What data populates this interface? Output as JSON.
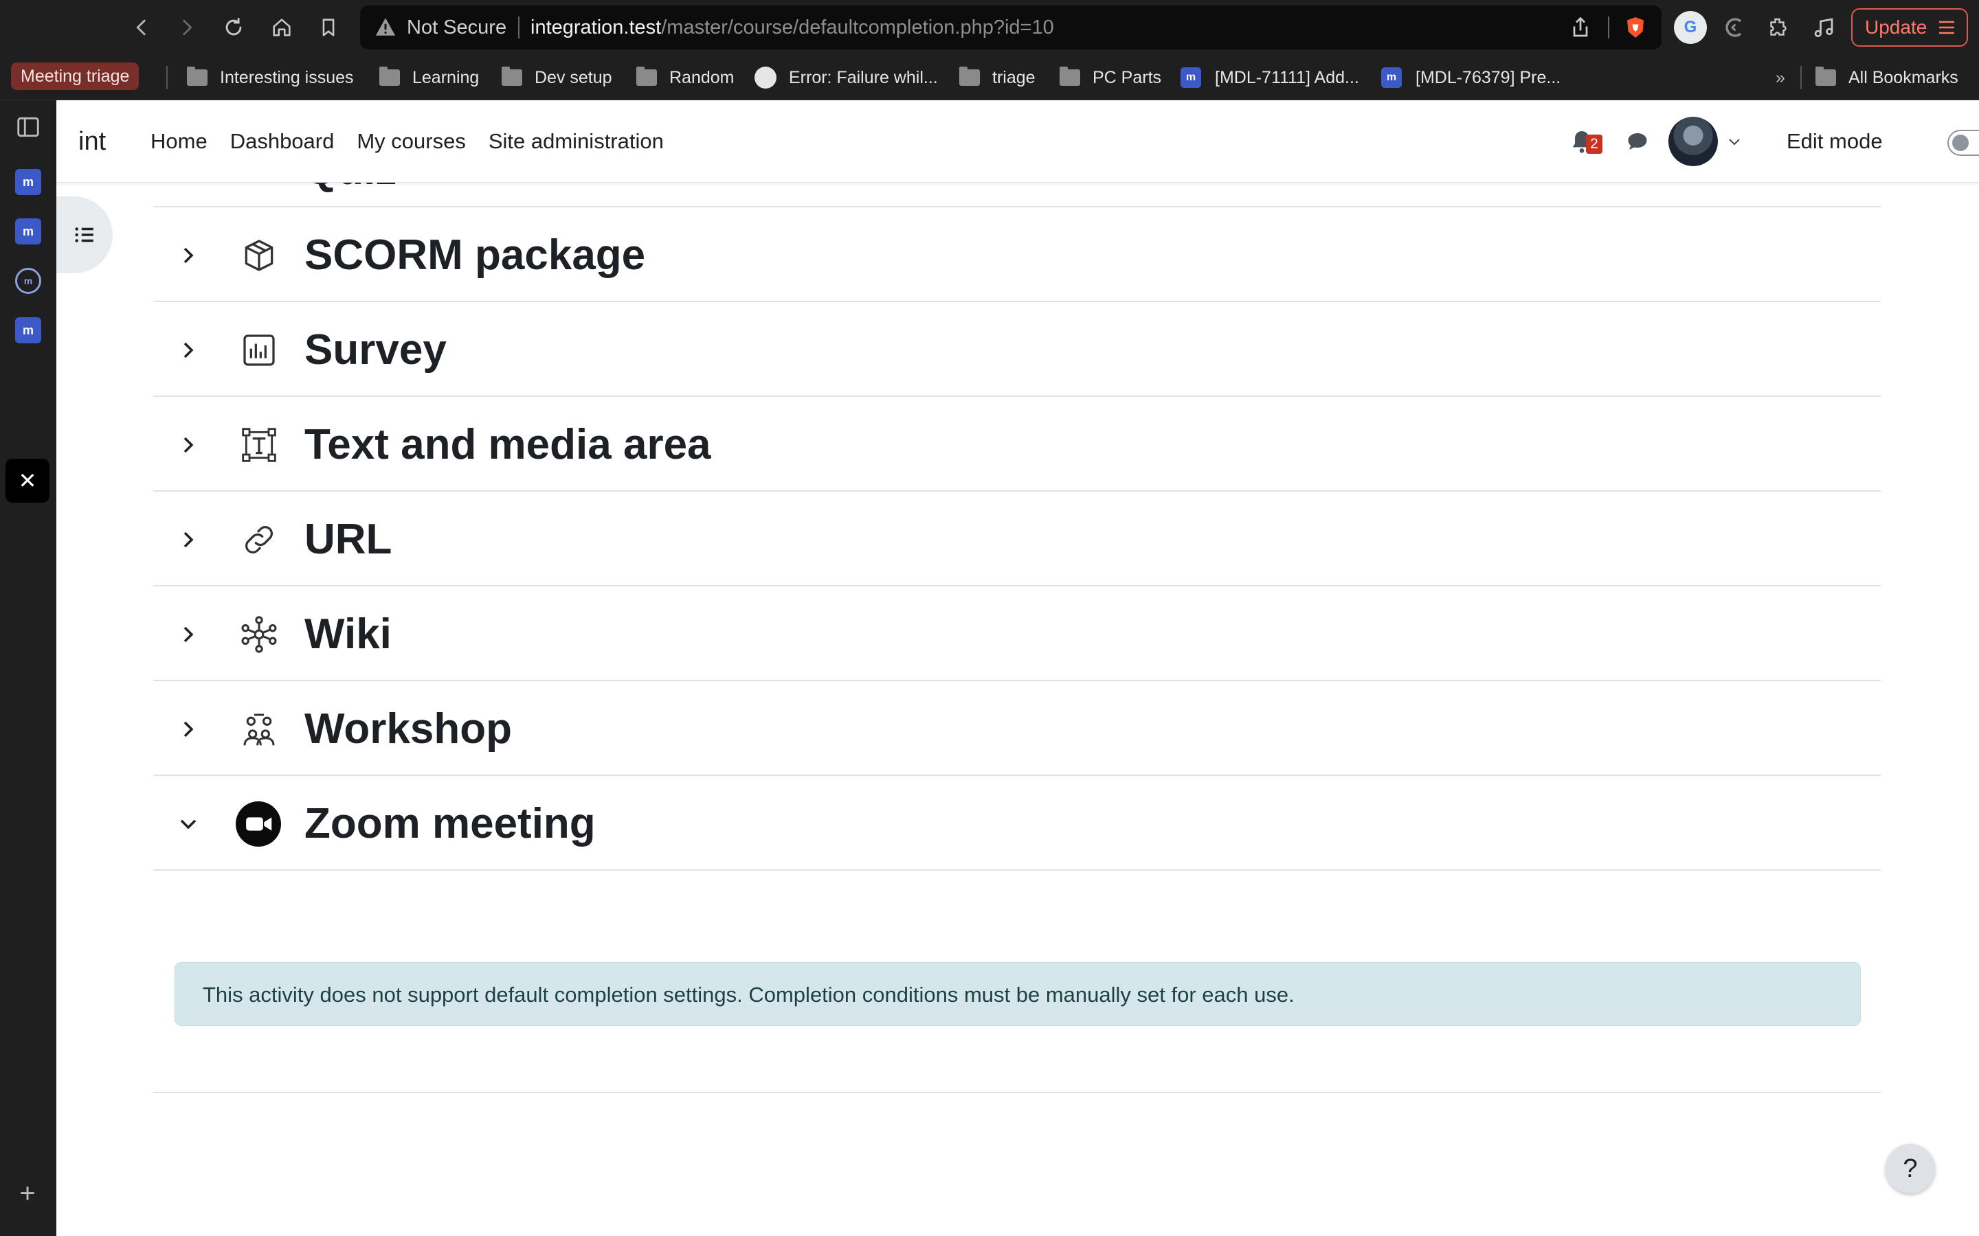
{
  "browser": {
    "url_warning": "Not Secure",
    "url_host": "integration.test",
    "url_path": "/master/course/defaultcompletion.php?id=10",
    "update_label": "Update",
    "bookmarks_overflow": "»",
    "all_bookmarks": "All Bookmarks",
    "bookmarks": [
      {
        "label": "Meeting triage",
        "icon": "tag"
      },
      {
        "label": "Interesting issues",
        "icon": "folder-icon"
      },
      {
        "label": "Learning",
        "icon": "folder-icon"
      },
      {
        "label": "Dev setup",
        "icon": "folder-icon"
      },
      {
        "label": "Random",
        "icon": "folder-icon"
      },
      {
        "label": "Error: Failure whil...",
        "icon": "github-icon"
      },
      {
        "label": "triage",
        "icon": "folder-icon"
      },
      {
        "label": "PC Parts",
        "icon": "folder-icon"
      },
      {
        "label": "[MDL-71111] Add...",
        "icon": "moodle-icon"
      },
      {
        "label": "[MDL-76379] Pre...",
        "icon": "moodle-icon"
      }
    ]
  },
  "navbar": {
    "brand": "int",
    "links": [
      "Home",
      "Dashboard",
      "My courses",
      "Site administration"
    ],
    "notification_count": "2",
    "edit_mode_label": "Edit mode",
    "edit_mode_on": false
  },
  "activities": [
    {
      "name": "Quiz",
      "icon": "quiz-icon",
      "expanded": false
    },
    {
      "name": "SCORM package",
      "icon": "scorm-package-icon",
      "expanded": false
    },
    {
      "name": "Survey",
      "icon": "survey-icon",
      "expanded": false
    },
    {
      "name": "Text and media area",
      "icon": "text-media-icon",
      "expanded": false
    },
    {
      "name": "URL",
      "icon": "link-icon",
      "expanded": false
    },
    {
      "name": "Wiki",
      "icon": "wiki-icon",
      "expanded": false
    },
    {
      "name": "Workshop",
      "icon": "workshop-icon",
      "expanded": false
    },
    {
      "name": "Zoom meeting",
      "icon": "zoom-icon",
      "expanded": true
    }
  ],
  "alert": {
    "text": "This activity does not support default completion settings. Completion conditions must be manually set for each use."
  },
  "help_label": "?",
  "colors": {
    "chrome_bg": "#1f1f1f",
    "alert_bg": "#d5e7ea",
    "badge": "#ca3120",
    "update_border": "#e2574c"
  }
}
